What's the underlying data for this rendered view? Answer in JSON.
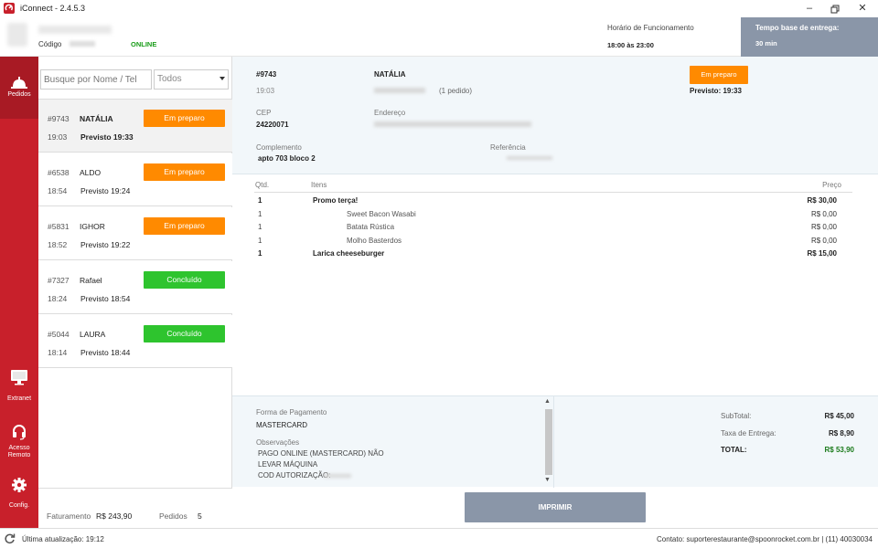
{
  "app": {
    "title": "iConnect - 2.4.5.3"
  },
  "header": {
    "codigo_label": "Código",
    "status": "ONLINE",
    "horario_label": "Horário de Funcionamento",
    "horario_value": "18:00 às 23:00",
    "tempo_label": "Tempo base de entrega:",
    "tempo_value": "30 min"
  },
  "sidebar": {
    "items": [
      {
        "label": "Pedidos",
        "icon": "bell-icon"
      },
      {
        "label": "Extranet",
        "icon": "monitor-icon"
      },
      {
        "label": "Acesso Remoto",
        "icon": "headset-icon"
      },
      {
        "label": "Config.",
        "icon": "gear-icon"
      }
    ]
  },
  "search": {
    "placeholder": "Busque por Nome / Tel",
    "filter_value": "Todos"
  },
  "orders": [
    {
      "id": "#9743",
      "name": "NATÁLIA",
      "time": "19:03",
      "previsto": "Previsto 19:33",
      "status": "Em preparo"
    },
    {
      "id": "#6538",
      "name": "ALDO",
      "time": "18:54",
      "previsto": "Previsto 19:24",
      "status": "Em preparo"
    },
    {
      "id": "#5831",
      "name": "IGHOR",
      "time": "18:52",
      "previsto": "Previsto 19:22",
      "status": "Em preparo"
    },
    {
      "id": "#7327",
      "name": "Rafael",
      "time": "18:24",
      "previsto": "Previsto 18:54",
      "status": "Concluído"
    },
    {
      "id": "#5044",
      "name": "LAURA",
      "time": "18:14",
      "previsto": "Previsto 18:44",
      "status": "Concluído"
    }
  ],
  "list_footer": {
    "faturamento_label": "Faturamento",
    "faturamento_value": "R$ 243,90",
    "pedidos_label": "Pedidos",
    "pedidos_value": "5"
  },
  "detail": {
    "id": "#9743",
    "time": "19:03",
    "name": "NATÁLIA",
    "pedido_count": "(1 pedido)",
    "status": "Em preparo",
    "previsto": "Previsto: 19:33",
    "cep_label": "CEP",
    "cep_value": "24220071",
    "endereco_label": "Endereço",
    "complemento_label": "Complemento",
    "complemento_value": "apto 703 bloco 2",
    "referencia_label": "Referência",
    "items_headers": {
      "qtd": "Qtd.",
      "itens": "Itens",
      "preco": "Preço"
    },
    "items": [
      {
        "qty": "1",
        "name": "Promo terça!",
        "price": "R$ 30,00",
        "main": true
      },
      {
        "qty": "1",
        "name": "Sweet Bacon Wasabi",
        "price": "R$ 0,00",
        "main": false
      },
      {
        "qty": "1",
        "name": "Batata Rústica",
        "price": "R$ 0,00",
        "main": false
      },
      {
        "qty": "1",
        "name": "Molho Basterdos",
        "price": "R$ 0,00",
        "main": false
      },
      {
        "qty": "1",
        "name": "Larica cheeseburger",
        "price": "R$ 15,00",
        "main": true
      }
    ],
    "pagamento_label": "Forma de Pagamento",
    "pagamento_value": "MASTERCARD",
    "observacoes_label": "Observações",
    "observacoes_lines": [
      "PAGO ONLINE (MASTERCARD) NÃO",
      "LEVAR MÁQUINA",
      "COD AUTORIZAÇÃO:"
    ],
    "subtotal_label": "SubTotal:",
    "subtotal_value": "R$ 45,00",
    "taxa_label": "Taxa de Entrega:",
    "taxa_value": "R$ 8,90",
    "total_label": "TOTAL:",
    "total_value": "R$ 53,90",
    "imprimir_label": "IMPRIMIR"
  },
  "statusbar": {
    "last_update": "Última atualização: 19:12",
    "contact": "Contato: suporterestaurante@spoonrocket.com.br | (11) 40030034"
  },
  "colors": {
    "brand": "#c8202b",
    "preparo": "#ff8a00",
    "concluido": "#2ec42e",
    "online": "#1a9d1a",
    "total": "#1a7a1a",
    "accent_gray": "#8a96a8"
  }
}
